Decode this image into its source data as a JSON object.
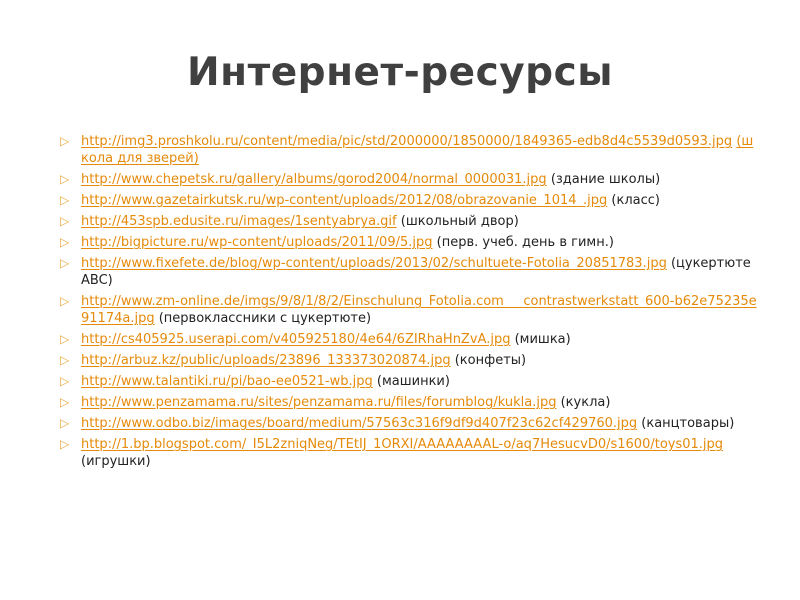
{
  "title": "Интернет-ресурсы",
  "colors": {
    "link": "#e58a0a",
    "bullet": "#e8a93d",
    "title": "#404040",
    "text": "#222222"
  },
  "bullet_icon": "triangle-right-outline-icon",
  "items": [
    {
      "url": "http://img3.proshkolu.ru/content/media/pic/std/2000000/1850000/1849365-edb8d4c5539d0593.jpg",
      "desc": "(школа для зверей)",
      "desc_is_link": true
    },
    {
      "url": "http://www.chepetsk.ru/gallery/albums/gorod2004/normal_0000031.jpg",
      "desc": "(здание школы)",
      "desc_is_link": false
    },
    {
      "url": "http://www.gazetairkutsk.ru/wp-content/uploads/2012/08/obrazovanie_1014_.jpg",
      "desc": "(класс)",
      "desc_is_link": false
    },
    {
      "url": "http://453spb.edusite.ru/images/1sentyabrya.gif",
      "desc": "(школьный двор)",
      "desc_is_link": false
    },
    {
      "url": "http://bigpicture.ru/wp-content/uploads/2011/09/5.jpg",
      "desc": "(перв. учеб. день в гимн.)",
      "desc_is_link": false
    },
    {
      "url": "http://www.fixefete.de/blog/wp-content/uploads/2013/02/schultuete-Fotolia_20851783.jpg",
      "desc": "(цукертюте ABC)",
      "desc_is_link": false
    },
    {
      "url": "http://www.zm-online.de/imgs/9/8/1/8/2/Einschulung_Fotolia.com___contrastwerkstatt_600-b62e75235e91174a.jpg",
      "desc": "(первоклассники с цукертюте)",
      "desc_is_link": false
    },
    {
      "url": "http://cs405925.userapi.com/v405925180/4e64/6ZIRhaHnZvA.jpg",
      "desc": "(мишка)",
      "desc_is_link": false
    },
    {
      "url": "http://arbuz.kz/public/uploads/23896_133373020874.jpg",
      "desc": "(конфеты)",
      "desc_is_link": false
    },
    {
      "url": "http://www.talantiki.ru/pi/bao-ee0521-wb.jpg",
      "desc": "(машинки)",
      "desc_is_link": false
    },
    {
      "url": "http://www.penzamama.ru/sites/penzamama.ru/files/forumblog/kukla.jpg",
      "desc": "(кукла)",
      "desc_is_link": false
    },
    {
      "url": "http://www.odbo.biz/images/board/medium/57563c316f9df9d407f23c62cf429760.jpg",
      "desc": "(канцтовары)",
      "desc_is_link": false
    },
    {
      "url": "http://1.bp.blogspot.com/_I5L2zniqNeg/TEtIJ_1ORXI/AAAAAAAAL-o/aq7HesucvD0/s1600/toys01.jpg",
      "desc": "(игрушки)",
      "desc_is_link": false
    }
  ]
}
